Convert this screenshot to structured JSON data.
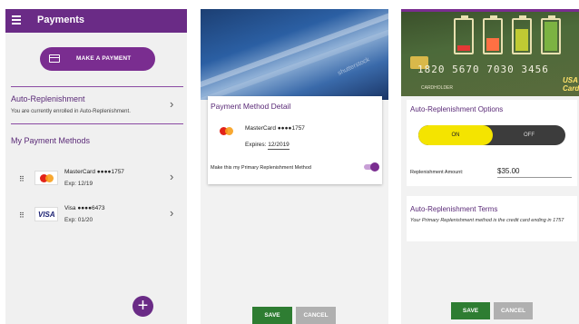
{
  "screen1": {
    "appbar_title": "Payments",
    "make_payment_label": "MAKE A PAYMENT",
    "auto_replenishment": {
      "title": "Auto-Replenishment",
      "subtitle": "You are currently enrolled in Auto-Replenishment."
    },
    "methods_title": "My Payment Methods",
    "methods": [
      {
        "brand": "MasterCard",
        "masked": "MasterCard ●●●●1757",
        "expiry": "Exp: 12/19"
      },
      {
        "brand": "VISA",
        "masked": "Visa ●●●●6473",
        "expiry": "Exp: 01/20"
      }
    ],
    "fab_label": "+"
  },
  "screen2": {
    "panel_title": "Payment Method Detail",
    "card_masked": "MasterCard ●●●●1757",
    "expires_label": "Expires:",
    "expires_value": "12/2019",
    "primary_label": "Make this my Primary Replenishment Method",
    "primary_enabled": true,
    "save_label": "SAVE",
    "cancel_label": "CANCEL",
    "watermark": "shutterstock"
  },
  "screen3": {
    "hero_digits": "1820 5670 7030 3456",
    "hero_brand": "USA Card",
    "hero_holder": "CARDHOLDER",
    "options_title": "Auto-Replenishment Options",
    "on_label": "ON",
    "off_label": "OFF",
    "selected": "ON",
    "amount_label": "Replenishment Amount:",
    "amount_value": "$35.00",
    "terms_title": "Auto-Replenishment Terms",
    "terms_text": "Your Primary Replenishment method is the credit card ending in 1757",
    "save_label": "SAVE",
    "cancel_label": "CANCEL"
  },
  "colors": {
    "brand_purple": "#6a2b86",
    "save_green": "#2e7d32",
    "cancel_gray": "#b0b0b0",
    "toggle_yellow": "#f4e400"
  }
}
